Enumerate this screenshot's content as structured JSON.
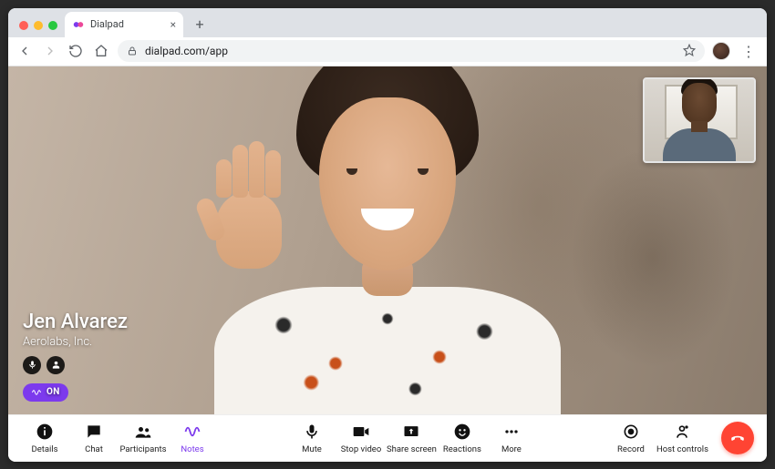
{
  "browser": {
    "tab_title": "Dialpad",
    "url": "dialpad.com/app"
  },
  "call": {
    "main_participant": {
      "name": "Jen Alvarez",
      "company": "Aerolabs, Inc."
    },
    "ai_badge": {
      "label": "ON"
    }
  },
  "controls": {
    "left": [
      {
        "key": "details",
        "label": "Details",
        "icon": "info"
      },
      {
        "key": "chat",
        "label": "Chat",
        "icon": "chat"
      },
      {
        "key": "participants",
        "label": "Participants",
        "icon": "people"
      },
      {
        "key": "notes",
        "label": "Notes",
        "icon": "ai-wave",
        "accent": true
      }
    ],
    "center": [
      {
        "key": "mute",
        "label": "Mute",
        "icon": "mic"
      },
      {
        "key": "stop-video",
        "label": "Stop video",
        "icon": "camera"
      },
      {
        "key": "share-screen",
        "label": "Share screen",
        "icon": "share"
      },
      {
        "key": "reactions",
        "label": "Reactions",
        "icon": "smile"
      },
      {
        "key": "more",
        "label": "More",
        "icon": "dots"
      }
    ],
    "right": [
      {
        "key": "record",
        "label": "Record",
        "icon": "record"
      },
      {
        "key": "host-controls",
        "label": "Host controls",
        "icon": "host"
      }
    ]
  }
}
